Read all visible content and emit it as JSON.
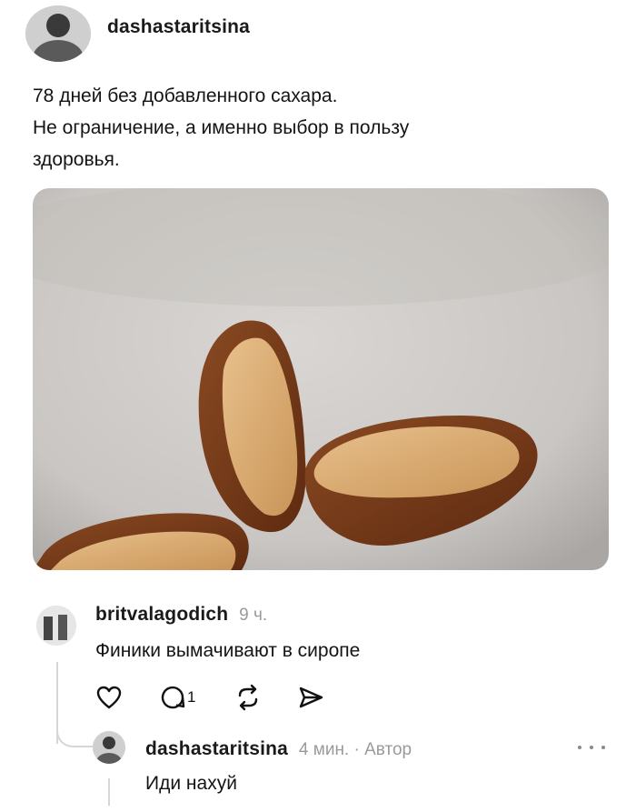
{
  "post": {
    "username": "dashastaritsina",
    "text_lines": [
      "78 дней без добавленного сахара.",
      "Не ограничение, а именно выбор в пользу",
      "здоровья."
    ],
    "image_alt": "Финики с арахисовой пастой на тарелке"
  },
  "reply": {
    "username": "britvalagodich",
    "time": "9 ч.",
    "text": "Финики вымачивают в сиропе",
    "comment_count": "1"
  },
  "author_reply": {
    "username": "dashastaritsina",
    "meta": "4 мин. · Автор",
    "text": "Иди нахуй"
  },
  "colors": {
    "text": "#141414",
    "meta": "#9a9a9a",
    "thread_line": "#d6d6d6"
  }
}
